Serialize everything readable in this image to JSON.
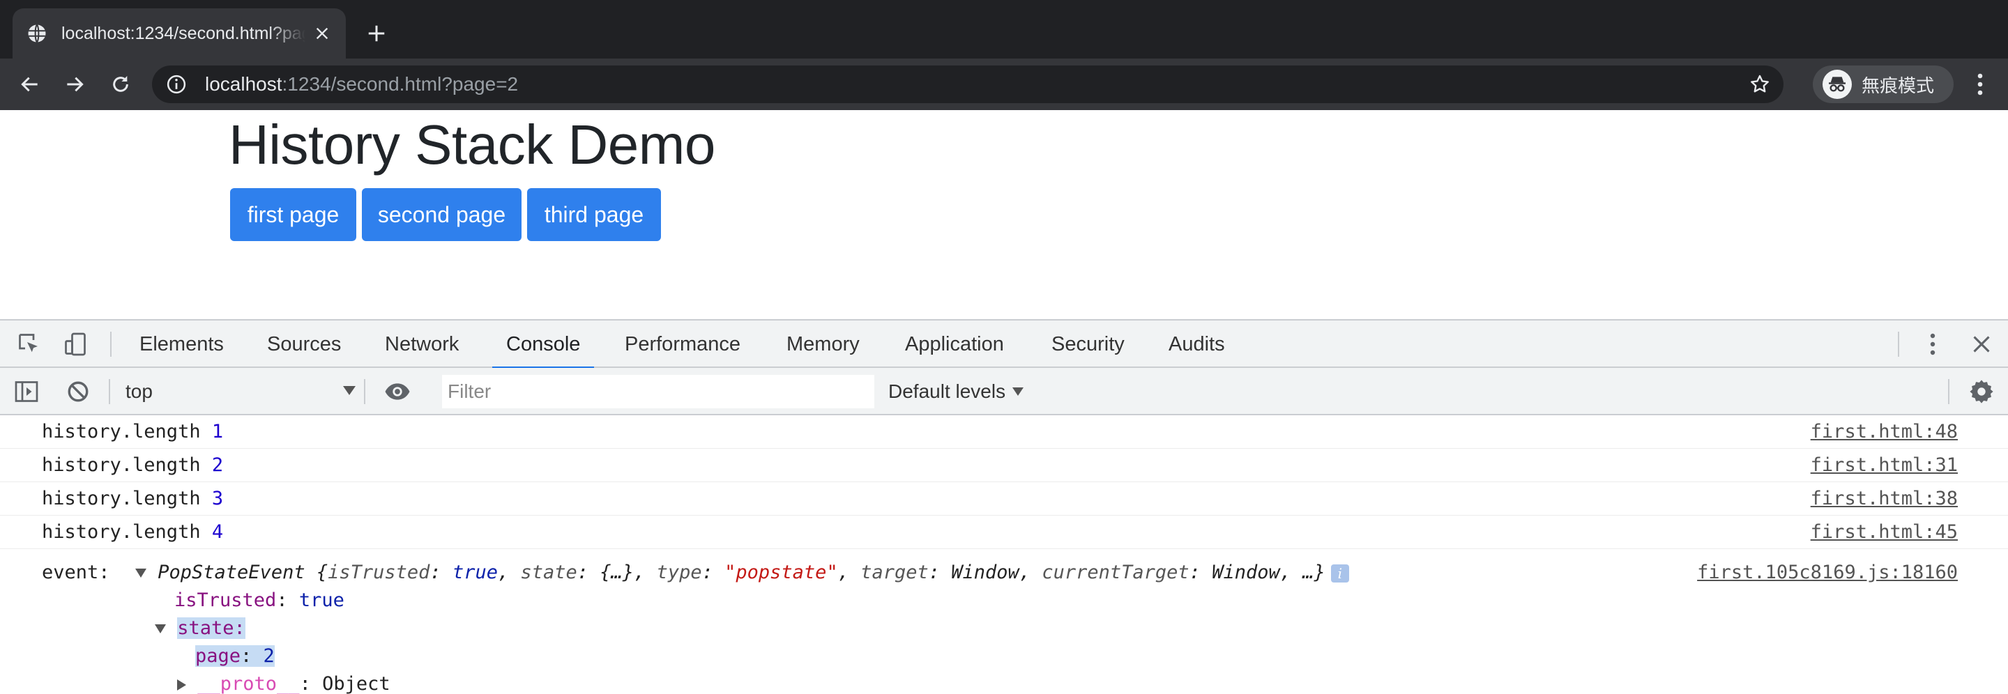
{
  "browser": {
    "tab_title": "localhost:1234/second.html?page=2",
    "url_host": "localhost",
    "url_rest": ":1234/second.html?page=2",
    "incognito_label": "無痕模式"
  },
  "page": {
    "heading": "History Stack Demo",
    "buttons": [
      "first page",
      "second page",
      "third page"
    ],
    "button_color": "#2f80ed"
  },
  "devtools": {
    "tabs": [
      "Elements",
      "Sources",
      "Network",
      "Console",
      "Performance",
      "Memory",
      "Application",
      "Security",
      "Audits"
    ],
    "active_tab": "Console",
    "context": "top",
    "filter_placeholder": "Filter",
    "levels": "Default levels"
  },
  "console": {
    "logs": [
      {
        "text": "history.length",
        "value": "1",
        "source": "first.html:48"
      },
      {
        "text": "history.length",
        "value": "2",
        "source": "first.html:31"
      },
      {
        "text": "history.length",
        "value": "3",
        "source": "first.html:38"
      },
      {
        "text": "history.length",
        "value": "4",
        "source": "first.html:45"
      }
    ],
    "event": {
      "label": "event:",
      "class_name": "PopStateEvent",
      "preview_open": "{",
      "k1": "isTrusted",
      "v1": "true",
      "k2": "state",
      "v2": "{…}",
      "k3": "type",
      "v3": "\"popstate\"",
      "k4": "target",
      "v4": "Window",
      "k5": "currentTarget",
      "v5": "Window",
      "tail": "…}",
      "source": "first.105c8169.js:18160",
      "is_trusted_key": "isTrusted",
      "is_trusted_value": "true",
      "state_key": "state:",
      "page_key": "page",
      "page_value": "2",
      "proto_key": "__proto__",
      "proto_value": "Object"
    }
  }
}
